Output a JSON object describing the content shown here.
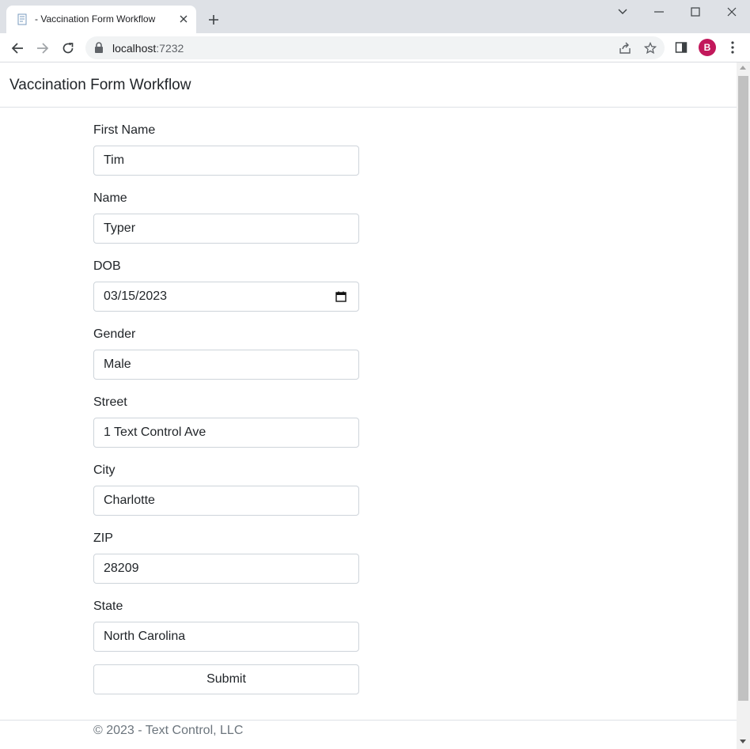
{
  "browser": {
    "tab_title": "- Vaccination Form Workflow",
    "url_host": "localhost",
    "url_port": ":7232",
    "profile_initial": "B"
  },
  "page": {
    "brand": "Vaccination Form Workflow",
    "footer": "© 2023 - Text Control, LLC"
  },
  "form": {
    "first_name": {
      "label": "First Name",
      "value": "Tim"
    },
    "name": {
      "label": "Name",
      "value": "Typer"
    },
    "dob": {
      "label": "DOB",
      "value": "03/15/2023"
    },
    "gender": {
      "label": "Gender",
      "value": "Male"
    },
    "street": {
      "label": "Street",
      "value": "1 Text Control Ave"
    },
    "city": {
      "label": "City",
      "value": "Charlotte"
    },
    "zip": {
      "label": "ZIP",
      "value": "28209"
    },
    "state": {
      "label": "State",
      "value": "North Carolina"
    },
    "submit_label": "Submit"
  },
  "colors": {
    "tabstrip": "#dee1e6",
    "avatar": "#c2185b",
    "border": "#ced4da"
  }
}
